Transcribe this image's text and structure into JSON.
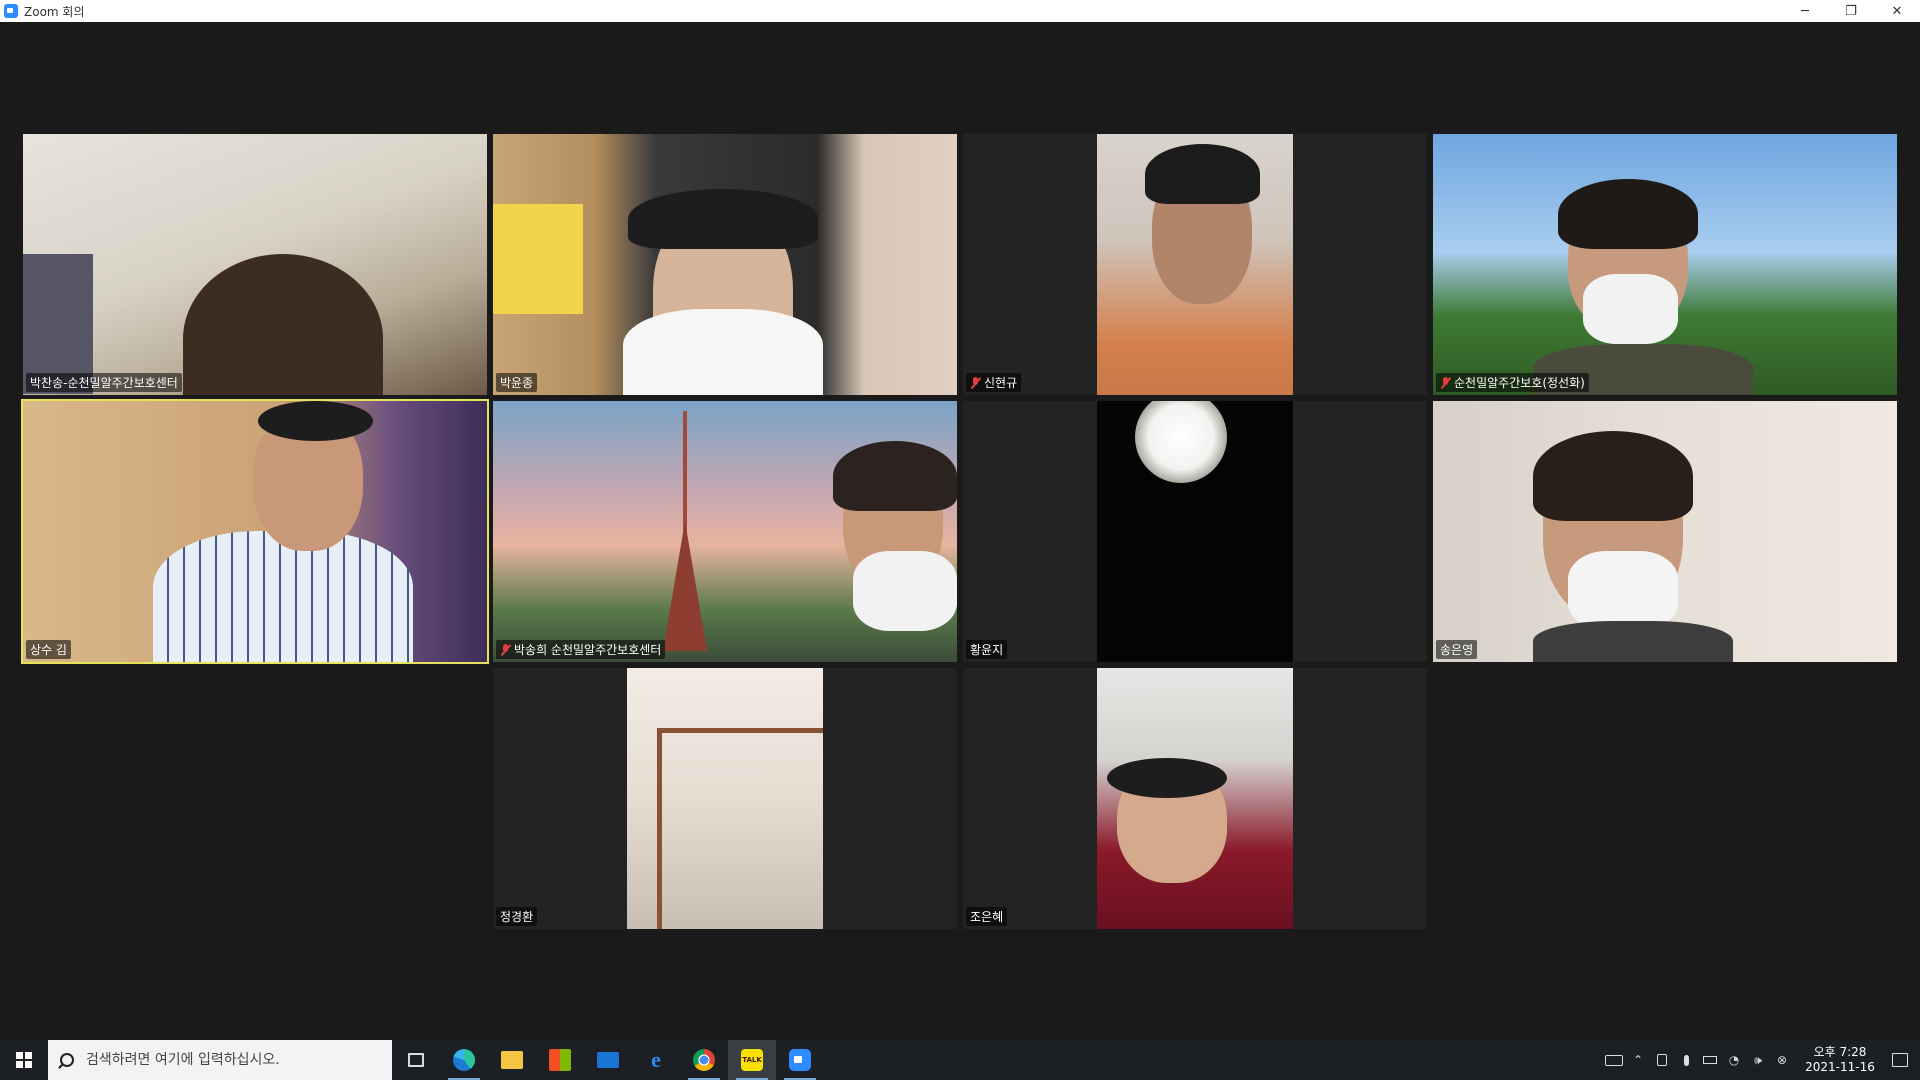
{
  "window": {
    "title": "Zoom 회의",
    "minimize": "─",
    "restore": "❐",
    "close": "✕"
  },
  "participants": [
    {
      "name": "박찬송-순천밀알주간보호센터",
      "muted": false,
      "active": false
    },
    {
      "name": "박윤종",
      "muted": false,
      "active": false
    },
    {
      "name": "신현규",
      "muted": true,
      "active": false
    },
    {
      "name": "순천밀알주간보호(정선화)",
      "muted": true,
      "active": false
    },
    {
      "name": "상수 김",
      "muted": false,
      "active": true
    },
    {
      "name": "박송희 순천밀알주간보호센터",
      "muted": true,
      "active": false
    },
    {
      "name": "황윤지",
      "muted": false,
      "active": false
    },
    {
      "name": "송은영",
      "muted": false,
      "active": false
    },
    {
      "name": "정경환",
      "muted": false,
      "active": false
    },
    {
      "name": "조은혜",
      "muted": false,
      "active": false
    }
  ],
  "taskbar": {
    "search_placeholder": "검색하려면 여기에 입력하십시오.",
    "apps": [
      "task-view",
      "edge",
      "file-explorer",
      "microsoft-store",
      "mail",
      "internet-explorer",
      "chrome",
      "kakaotalk",
      "zoom"
    ],
    "kakaotalk_label": "TALK"
  },
  "tray": {
    "ampm_time": "오후 7:28",
    "date": "2021-11-16"
  }
}
